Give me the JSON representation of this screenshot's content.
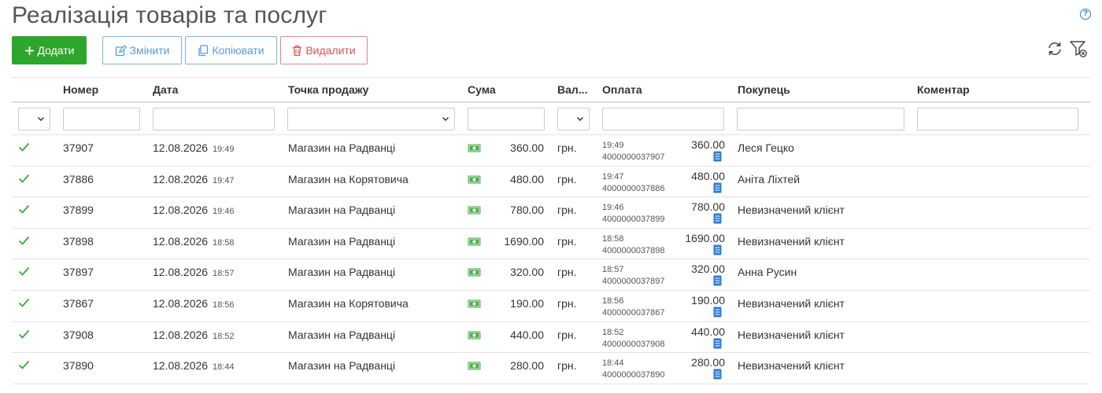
{
  "page": {
    "title": "Реалізація товарів та послуг",
    "help": "?"
  },
  "toolbar": {
    "add_label": "Додати",
    "edit_label": "Змінити",
    "copy_label": "Копіювати",
    "delete_label": "Видалити"
  },
  "columns": {
    "number": "Номер",
    "date": "Дата",
    "point": "Точка продажу",
    "sum": "Сума",
    "currency": "Вал...",
    "payment": "Оплата",
    "buyer": "Покупець",
    "comment": "Коментар"
  },
  "colors": {
    "add": "#2ea52c",
    "check": "#3aa83a",
    "cash": "#4caf50",
    "receipt": "#2a7bd6"
  },
  "rows": [
    {
      "number": "37907",
      "date": "12.08.2026",
      "time": "19:49",
      "point": "Магазин на Радванці",
      "sum": "360.00",
      "currency": "грн.",
      "pay_time": "19:49",
      "pay_id": "4000000037907",
      "pay_amount": "360.00",
      "buyer": "Леся Гецко"
    },
    {
      "number": "37886",
      "date": "12.08.2026",
      "time": "19:47",
      "point": "Магазин на Корятовича",
      "sum": "480.00",
      "currency": "грн.",
      "pay_time": "19:47",
      "pay_id": "4000000037886",
      "pay_amount": "480.00",
      "buyer": "Аніта Ліхтей"
    },
    {
      "number": "37899",
      "date": "12.08.2026",
      "time": "19:46",
      "point": "Магазин на Радванці",
      "sum": "780.00",
      "currency": "грн.",
      "pay_time": "19:46",
      "pay_id": "4000000037899",
      "pay_amount": "780.00",
      "buyer": "Невизначений клієнт"
    },
    {
      "number": "37898",
      "date": "12.08.2026",
      "time": "18:58",
      "point": "Магазин на Радванці",
      "sum": "1690.00",
      "currency": "грн.",
      "pay_time": "18:58",
      "pay_id": "4000000037898",
      "pay_amount": "1690.00",
      "buyer": "Невизначений клієнт"
    },
    {
      "number": "37897",
      "date": "12.08.2026",
      "time": "18:57",
      "point": "Магазин на Радванці",
      "sum": "320.00",
      "currency": "грн.",
      "pay_time": "18:57",
      "pay_id": "4000000037897",
      "pay_amount": "320.00",
      "buyer": "Анна Русин"
    },
    {
      "number": "37867",
      "date": "12.08.2026",
      "time": "18:56",
      "point": "Магазин на Корятовича",
      "sum": "190.00",
      "currency": "грн.",
      "pay_time": "18:56",
      "pay_id": "4000000037867",
      "pay_amount": "190.00",
      "buyer": "Невизначений клієнт"
    },
    {
      "number": "37908",
      "date": "12.08.2026",
      "time": "18:52",
      "point": "Магазин на Радванці",
      "sum": "440.00",
      "currency": "грн.",
      "pay_time": "18:52",
      "pay_id": "4000000037908",
      "pay_amount": "440.00",
      "buyer": "Невизначений клієнт"
    },
    {
      "number": "37890",
      "date": "12.08.2026",
      "time": "18:44",
      "point": "Магазин на Радванці",
      "sum": "280.00",
      "currency": "грн.",
      "pay_time": "18:44",
      "pay_id": "4000000037890",
      "pay_amount": "280.00",
      "buyer": "Невизначений клієнт"
    }
  ]
}
